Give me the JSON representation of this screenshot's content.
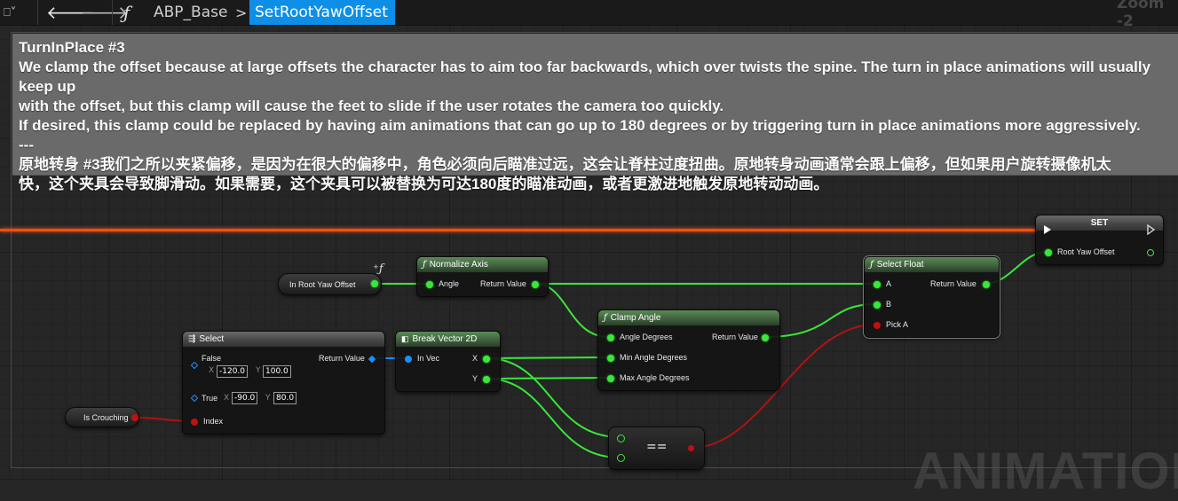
{
  "toolbar": {
    "bookmark_icon": "bookmark-icon",
    "back_icon": "back-arrow-icon",
    "forward_icon": "forward-arrow-icon",
    "function_symbol": "ƒ",
    "breadcrumb_blueprint": "ABP_Base",
    "breadcrumb_separator": ">",
    "breadcrumb_function": "SetRootYawOffset",
    "zoom_label": "Zoom -2"
  },
  "comment": {
    "text": "TurnInPlace #3\nWe clamp the offset because at large offsets the character has to aim too far backwards, which over twists the spine. The turn in place animations will usually keep up\nwith the offset, but this clamp will cause the feet to slide if the user rotates the camera too quickly.\nIf desired, this clamp could be replaced by having aim animations that can go up to 180 degrees or by triggering turn in place animations more aggressively.\n---\n原地转身 #3我们之所以夹紧偏移，是因为在很大的偏移中，角色必须向后瞄准过远，这会让脊柱过度扭曲。原地转身动画通常会跟上偏移，但如果用户旋转摄像机太\n快，这个夹具会导致脚滑动。如果需要，这个夹具可以被替换为可达180度的瞄准动画，或者更激进地触发原地转动动画。"
  },
  "nodes": {
    "set": {
      "title": "SET",
      "pin": "Root Yaw Offset"
    },
    "normalize": {
      "title": "Normalize Axis",
      "in": "Angle",
      "out": "Return Value"
    },
    "select_float": {
      "title": "Select Float",
      "a": "A",
      "b": "B",
      "pick": "Pick A",
      "out": "Return Value"
    },
    "clamp": {
      "title": "Clamp Angle",
      "in": "Angle Degrees",
      "min": "Min Angle Degrees",
      "max": "Max Angle Degrees",
      "out": "Return Value"
    },
    "select": {
      "title": "Select",
      "false_label": "False",
      "true_label": "True",
      "index": "Index",
      "out": "Return Value",
      "false_x": "-120.0",
      "false_y": "100.0",
      "true_x": "-90.0",
      "true_y": "80.0",
      "x_axis": "X",
      "y_axis": "Y"
    },
    "break_vector": {
      "title": "Break Vector 2D",
      "in": "In Vec",
      "x": "X",
      "y": "Y"
    },
    "equal": {
      "op": "=="
    },
    "root_yaw_var": {
      "label": "In Root Yaw Offset"
    },
    "is_crouching_var": {
      "label": "Is Crouching"
    }
  },
  "colors": {
    "exec_wire": "#ff4a10",
    "float_pin": "#38e838",
    "bool_pin": "#c01010",
    "struct_pin": "#1a8fff",
    "active_crumb": "#0d8fe8"
  },
  "watermark": "ANIMATION"
}
